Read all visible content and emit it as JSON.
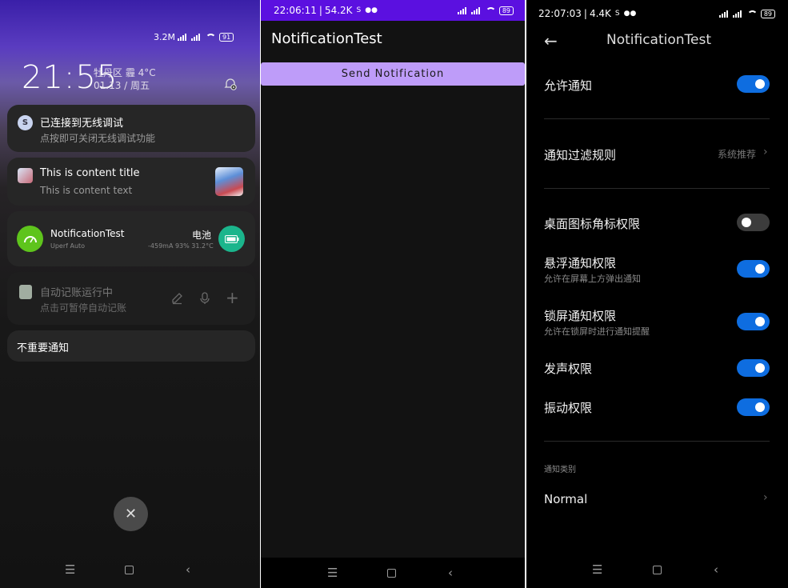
{
  "panel1": {
    "status": {
      "speed": "3.2M",
      "battery": "91"
    },
    "clock": {
      "time": "21:55",
      "location_weather": "牡丹区 霾 4°C",
      "date": "01.13 / 周五"
    },
    "notifications": [
      {
        "title": "已连接到无线调试",
        "text": "点按即可关闭无线调试功能",
        "icon": "debug-icon"
      },
      {
        "title": "This is content title",
        "text": "This is content text",
        "icon": "app-avatar-icon"
      },
      {
        "title": "NotificationTest",
        "subtitle": "Uperf Auto",
        "right_title": "电池",
        "right_text": "-459mA 93% 31.2°C",
        "icon": "speedometer-icon"
      },
      {
        "title": "自动记账运行中",
        "text": "点击可暂停自动记账",
        "icon": "ledger-icon"
      }
    ],
    "unimportant_label": "不重要通知",
    "colors": {
      "green": "#5ec41c",
      "teal": "#1bb58c"
    }
  },
  "panel2": {
    "status": {
      "time": "22:06:11",
      "speed": "54.2K",
      "battery": "89"
    },
    "app_title": "NotificationTest",
    "send_button_label": "Send Notification"
  },
  "panel3": {
    "status": {
      "time": "22:07:03",
      "speed": "4.4K",
      "battery": "89"
    },
    "title": "NotificationTest",
    "allow_notifications": {
      "label": "允许通知",
      "on": true
    },
    "filter_rule": {
      "label": "通知过滤规则",
      "value": "系统推荐"
    },
    "permissions": [
      {
        "label": "桌面图标角标权限",
        "sub": "",
        "on": false
      },
      {
        "label": "悬浮通知权限",
        "sub": "允许在屏幕上方弹出通知",
        "on": true
      },
      {
        "label": "锁屏通知权限",
        "sub": "允许在锁屏时进行通知提醒",
        "on": true
      },
      {
        "label": "发声权限",
        "sub": "",
        "on": true
      },
      {
        "label": "振动权限",
        "sub": "",
        "on": true
      }
    ],
    "category_header": "通知类别",
    "category_item": "Normal",
    "accent": "#0e6de0"
  }
}
